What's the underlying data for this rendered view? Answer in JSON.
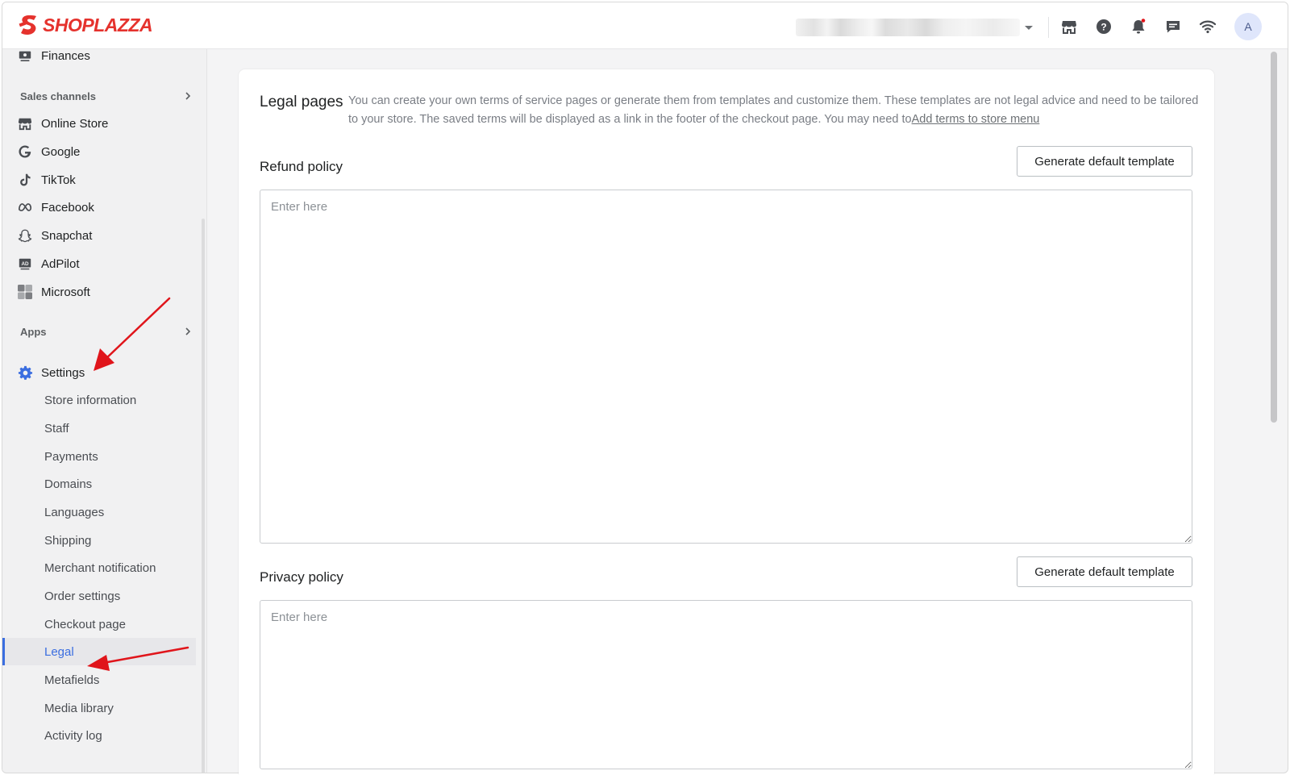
{
  "brand": {
    "name": "SHOPLAZZA",
    "color": "#e5322d"
  },
  "topbar": {
    "avatar_initial": "A",
    "icons": [
      "store-icon",
      "help-icon",
      "notification-bell-icon",
      "chat-icon",
      "wifi-icon"
    ]
  },
  "sidebar": {
    "top_item": {
      "label": "Finances",
      "icon": "finances-icon"
    },
    "sales_channels": {
      "label": "Sales channels",
      "items": [
        {
          "label": "Online Store",
          "icon": "store-icon"
        },
        {
          "label": "Google",
          "icon": "google-icon"
        },
        {
          "label": "TikTok",
          "icon": "tiktok-icon"
        },
        {
          "label": "Facebook",
          "icon": "meta-icon"
        },
        {
          "label": "Snapchat",
          "icon": "snapchat-icon"
        },
        {
          "label": "AdPilot",
          "icon": "adpilot-icon"
        },
        {
          "label": "Microsoft",
          "icon": "microsoft-icon"
        }
      ]
    },
    "apps": {
      "label": "Apps"
    },
    "settings": {
      "label": "Settings",
      "icon": "gear-icon",
      "items": [
        {
          "label": "Store information"
        },
        {
          "label": "Staff"
        },
        {
          "label": "Payments"
        },
        {
          "label": "Domains"
        },
        {
          "label": "Languages"
        },
        {
          "label": "Shipping"
        },
        {
          "label": "Merchant notification"
        },
        {
          "label": "Order settings"
        },
        {
          "label": "Checkout page"
        },
        {
          "label": "Legal",
          "active": true
        },
        {
          "label": "Metafields"
        },
        {
          "label": "Media library"
        },
        {
          "label": "Activity log"
        }
      ]
    }
  },
  "main": {
    "title": "Legal pages",
    "description": "You can create your own terms of service pages or generate them from templates and customize them. These templates are not legal advice and need to be tailored to your store. The saved terms will be displayed as a link in the footer of the checkout page. You may need to",
    "description_link": "Add terms to store menu",
    "policies": [
      {
        "label": "Refund policy",
        "button": "Generate default template",
        "placeholder": "Enter here",
        "value": ""
      },
      {
        "label": "Privacy policy",
        "button": "Generate default template",
        "placeholder": "Enter here",
        "value": ""
      }
    ]
  },
  "colors": {
    "accent": "#3b6ee0",
    "annotation_arrow": "#e0151b"
  }
}
